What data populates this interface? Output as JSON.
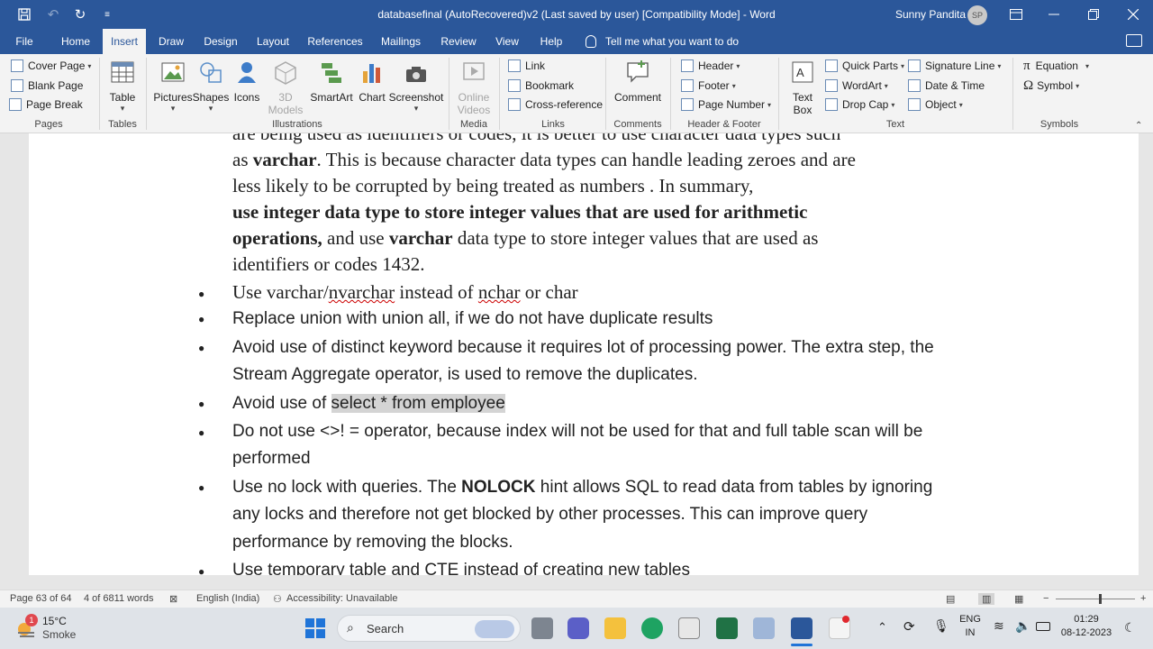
{
  "window": {
    "title": "databasefinal (AutoRecovered)v2 (Last saved by user) [Compatibility Mode] - Word",
    "user_name": "Sunny Pandita",
    "user_initials": "SP"
  },
  "quick_access": {
    "save_icon": "save-icon",
    "undo_icon": "undo-icon",
    "redo_icon": "redo-icon",
    "customize_icon": "customize-icon"
  },
  "menu_tabs": [
    "File",
    "Home",
    "Insert",
    "Draw",
    "Design",
    "Layout",
    "References",
    "Mailings",
    "Review",
    "View",
    "Help"
  ],
  "active_tab": "Insert",
  "tell_me": "Tell me what you want to do",
  "ribbon": {
    "pages": {
      "cover_page": "Cover Page",
      "blank_page": "Blank Page",
      "page_break": "Page Break",
      "label": "Pages"
    },
    "tables": {
      "table": "Table",
      "label": "Tables"
    },
    "illustrations": {
      "pictures": "Pictures",
      "shapes": "Shapes",
      "icons": "Icons",
      "models_3d_1": "3D",
      "models_3d_2": "Models",
      "smartart": "SmartArt",
      "chart": "Chart",
      "screenshot": "Screenshot",
      "label": "Illustrations"
    },
    "media": {
      "online_videos_1": "Online",
      "online_videos_2": "Videos",
      "label": "Media"
    },
    "links": {
      "link": "Link",
      "bookmark": "Bookmark",
      "cross_reference": "Cross-reference",
      "label": "Links"
    },
    "comments": {
      "comment": "Comment",
      "label": "Comments"
    },
    "header_footer": {
      "header": "Header",
      "footer": "Footer",
      "page_number": "Page Number",
      "label": "Header & Footer"
    },
    "text": {
      "text_box_1": "Text",
      "text_box_2": "Box",
      "quick_parts": "Quick Parts",
      "wordart": "WordArt",
      "drop_cap": "Drop Cap",
      "signature_line": "Signature Line",
      "date_time": "Date & Time",
      "object": "Object",
      "label": "Text"
    },
    "symbols": {
      "equation": "Equation",
      "symbol": "Symbol",
      "label": "Symbols"
    }
  },
  "document": {
    "line1": "are being used as identifiers or codes, it is better to use character data types such",
    "line2_a": "as ",
    "line2_b": "varchar",
    "line2_c": ". This is because character data types can handle leading zeroes and are",
    "line3": "less likely to be corrupted by being treated as numbers . In summary,",
    "line4": "use integer data type to store integer values that are used for arithmetic",
    "line5_a": "operations,",
    "line5_b": " and use ",
    "line5_c": "varchar",
    "line5_d": " data type to store integer values that are used as",
    "line6": "identifiers or codes 1432.",
    "b1_a": "Use varchar/",
    "b1_b": "nvarchar",
    "b1_c": " instead of ",
    "b1_d": "nchar",
    "b1_e": " or char",
    "b2": "Replace union with union all, if we do not have duplicate results",
    "b3_l1": "Avoid use of distinct keyword because it requires lot of processing power. The extra step, the",
    "b3_l2": "Stream Aggregate operator, is used to remove the duplicates.",
    "b4_a": "Avoid use of ",
    "b4_b": "select * from employee ",
    "b5_l1": "Do not use <>! = operator, because index will not be used for that and full table scan will be",
    "b5_l2": "performed",
    "b6_a": "Use no lock with queries. The ",
    "b6_b": "NOLOCK",
    "b6_c": " hint allows SQL to read data from tables by ignoring",
    "b6_l2": "any locks and therefore not get blocked by other processes. This can improve query",
    "b6_l3": "performance by removing the blocks.",
    "b7": "Use temporary table and CTE instead of creating new tables"
  },
  "status": {
    "page": "Page 63 of 64",
    "words": "4 of 6811 words",
    "language": "English (India)",
    "accessibility": "Accessibility: Unavailable"
  },
  "taskbar": {
    "weather_temp": "15°C",
    "weather_desc": "Smoke",
    "weather_badge": "1",
    "search": "Search",
    "lang_1": "ENG",
    "lang_2": "IN",
    "time": "01:29",
    "date": "08-12-2023"
  }
}
